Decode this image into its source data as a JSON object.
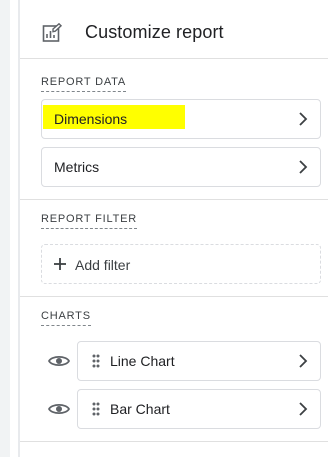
{
  "header": {
    "title": "Customize report",
    "icon": "edit-report-icon"
  },
  "report_data": {
    "label": "REPORT DATA",
    "items": [
      {
        "label": "Dimensions",
        "highlight_color": "#ffff00"
      },
      {
        "label": "Metrics"
      }
    ]
  },
  "report_filter": {
    "label": "REPORT FILTER",
    "add_label": "Add filter"
  },
  "charts": {
    "label": "CHARTS",
    "items": [
      {
        "label": "Line Chart",
        "visible": true
      },
      {
        "label": "Bar Chart",
        "visible": true
      }
    ]
  },
  "colors": {
    "text": "#202124",
    "border": "#dadce0",
    "icon": "#5f6368",
    "highlight": "#ffff00"
  }
}
